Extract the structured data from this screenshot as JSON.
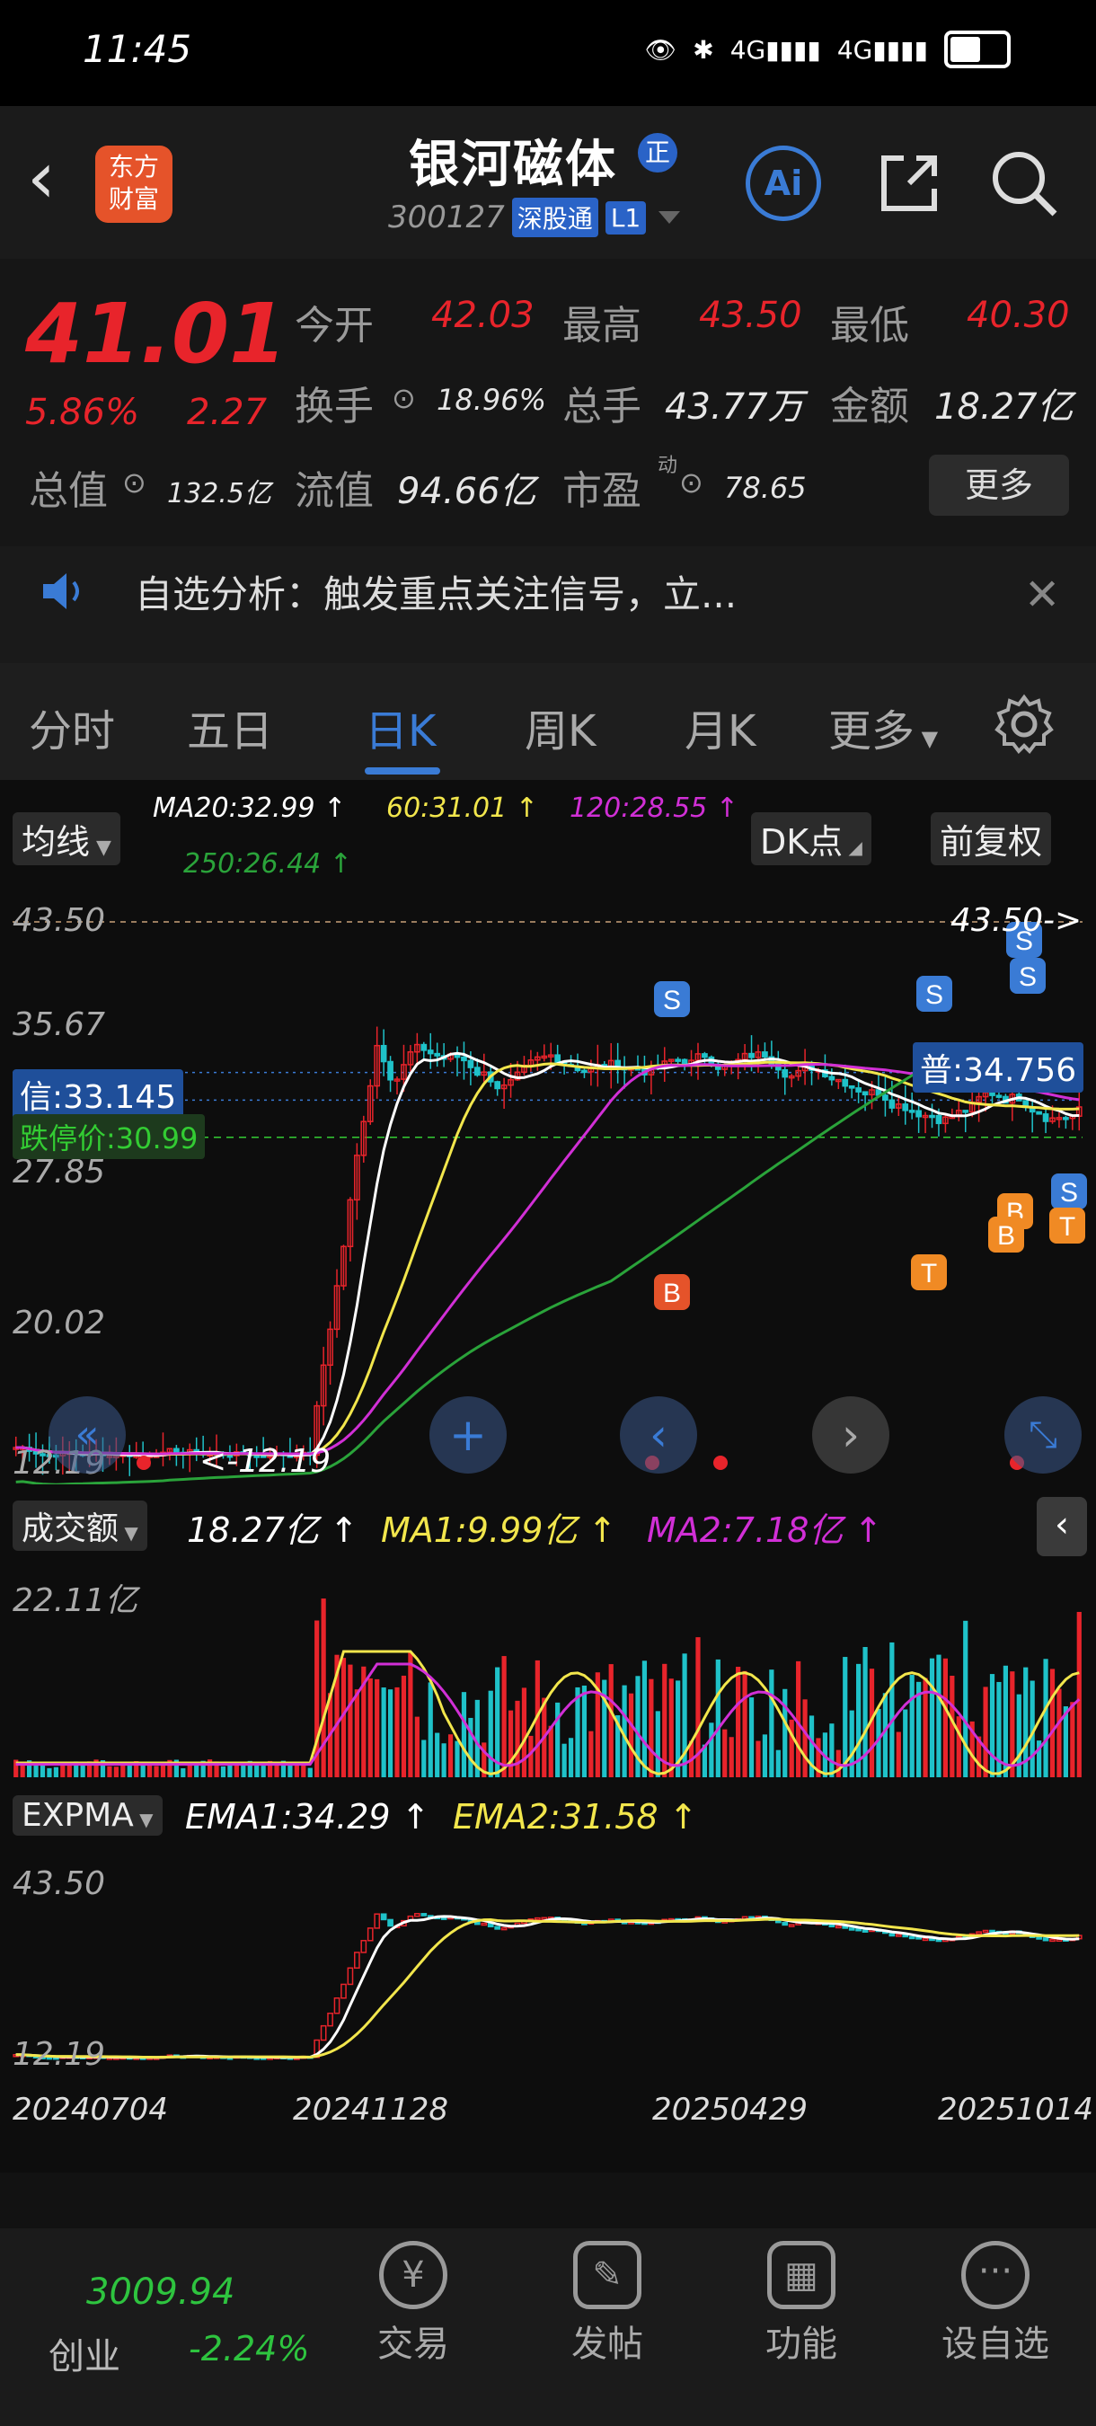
{
  "status_bar": {
    "time": "11:45",
    "net1": "4G",
    "net2": "4G"
  },
  "header": {
    "app_logo": "东方\n财富",
    "stock_name": "银河磁体",
    "badge": "正",
    "code": "300127",
    "tag1": "深股通",
    "tag2": "L1",
    "ai_label": "Ai"
  },
  "quote": {
    "price": "41.01",
    "change_pct": "5.86%",
    "change": "2.27",
    "open_label": "今开",
    "open": "42.03",
    "high_label": "最高",
    "high": "43.50",
    "low_label": "最低",
    "low": "40.30",
    "turnover_label": "换手",
    "turnover": "18.96%",
    "volume_label": "总手",
    "volume": "43.77万",
    "amount_label": "金额",
    "amount": "18.27亿",
    "mktcap_label": "总值",
    "mktcap": "132.5亿",
    "float_label": "流值",
    "float": "94.66亿",
    "pe_label": "市盈",
    "pe_sup": "动",
    "pe": "78.65",
    "more": "更多"
  },
  "notice": {
    "text": "自选分析：触发重点关注信号，立..."
  },
  "tabs": [
    "分时",
    "五日",
    "日K",
    "周K",
    "月K",
    "更多"
  ],
  "active_tab": "日K",
  "kline": {
    "ma_button": "均线",
    "ma20": "MA20:32.99 ↑",
    "ma60": "60:31.01 ↑",
    "ma120": "120:28.55 ↑",
    "ma250": "250:26.44 ↑",
    "dk_button": "DK点",
    "fq_button": "前复权",
    "y_ticks": [
      "43.50",
      "35.67",
      "27.85",
      "20.02",
      "12.19"
    ],
    "high_marker": "43.50->",
    "low_marker": "<-12.19",
    "xin_label": "信:33.145",
    "limit_down": "跌停价:30.99",
    "pu_label": "普:34.756",
    "colors": {
      "up": "#e8242b",
      "down": "#1fc2c9",
      "ma20": "#ffffff",
      "ma60": "#f2e64c",
      "ma120": "#d12fd6",
      "ma250": "#2aa33a"
    }
  },
  "volume": {
    "selector": "成交额",
    "value": "18.27亿 ↑",
    "ma1": "MA1:9.99亿 ↑",
    "ma2": "MA2:7.18亿 ↑",
    "y_top": "22.11亿"
  },
  "expma": {
    "selector": "EXPMA",
    "ema1": "EMA1:34.29 ↑",
    "ema2": "EMA2:31.58 ↑",
    "y_top": "43.50",
    "y_bottom": "12.19"
  },
  "dates": [
    "20240704",
    "20241128",
    "20250429",
    "20251014"
  ],
  "bottom_nav": {
    "index_value": "3009.94",
    "index_name": "创业",
    "index_change": "-2.24%",
    "items": [
      "交易",
      "发帖",
      "功能",
      "设自选"
    ]
  }
}
